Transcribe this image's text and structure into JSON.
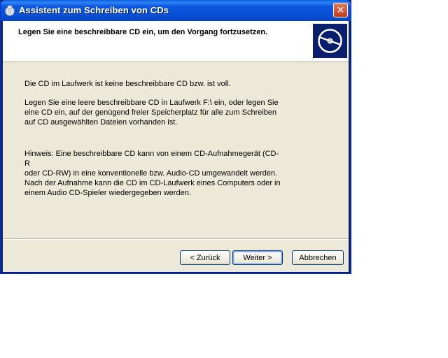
{
  "window": {
    "title": "Assistent zum Schreiben von CDs",
    "close_label": "✕"
  },
  "header": {
    "title": "Legen Sie eine beschreibbare CD ein, um den Vorgang fortzusetzen."
  },
  "body": {
    "line1": "Die CD im Laufwerk ist keine beschreibbare CD bzw. ist voll.",
    "para2": [
      "Legen Sie eine leere beschreibbare CD in Laufwerk F:\\ ein, oder legen Sie",
      "eine CD ein, auf der genügend freier Speicherplatz für alle zum Schreiben",
      "auf CD ausgewählten Dateien vorhanden ist."
    ],
    "para3": [
      "Hinweis: Eine beschreibbare CD kann von einem CD-Aufnahmegerät (CD-R",
      "oder CD-RW) in eine konventionelle bzw. Audio-CD umgewandelt werden.",
      "Nach der Aufnahme kann die CD im CD-Laufwerk eines Computers oder in",
      "einem Audio CD-Spieler wiedergegeben werden."
    ]
  },
  "buttons": {
    "back": "< Zurück",
    "next": "Weiter >",
    "cancel": "Abbrechen"
  }
}
